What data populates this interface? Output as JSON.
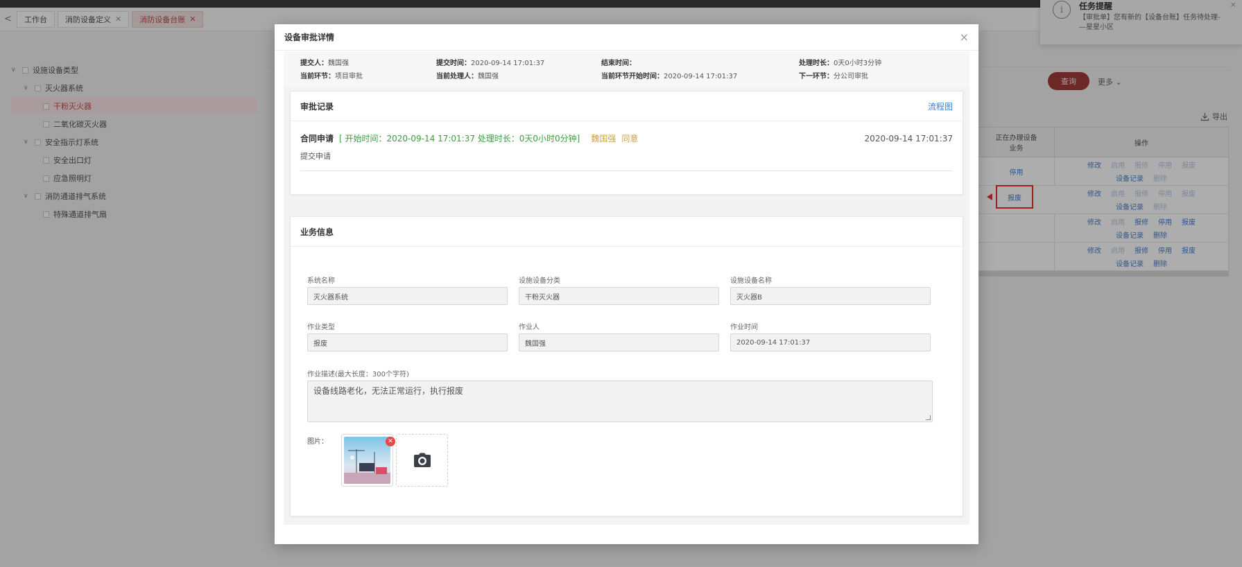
{
  "tabbar": {
    "nav": "<",
    "tabs": [
      {
        "label": "工作台",
        "closable": false,
        "active": false
      },
      {
        "label": "消防设备定义",
        "closable": true,
        "active": false
      },
      {
        "label": "消防设备台账",
        "closable": true,
        "active": true
      }
    ]
  },
  "tree": {
    "items": [
      {
        "label": "设施设备类型",
        "level": 1,
        "expanded": true
      },
      {
        "label": "灭火器系统",
        "level": 2,
        "expanded": true
      },
      {
        "label": "干粉灭火器",
        "level": 3,
        "selected": true
      },
      {
        "label": "二氧化碳灭火器",
        "level": 3
      },
      {
        "label": "安全指示灯系统",
        "level": 2,
        "expanded": true
      },
      {
        "label": "安全出口灯",
        "level": 3
      },
      {
        "label": "应急照明灯",
        "level": 3
      },
      {
        "label": "消防通道排气系统",
        "level": 2,
        "expanded": true
      },
      {
        "label": "特殊通道排气扇",
        "level": 3
      }
    ]
  },
  "toolbar": {
    "query_label": "查询",
    "more_label": "更多",
    "export_label": "导出"
  },
  "table": {
    "headers": {
      "busy": "正在办理设备业务",
      "ops": "操作"
    },
    "rows": [
      {
        "busy": "停用",
        "ops1": [
          "修改",
          "启用",
          "报修",
          "停用",
          "报废"
        ],
        "ops2": [
          "设备记录",
          "删除"
        ],
        "enabled1": [
          true,
          false,
          false,
          false,
          false
        ],
        "enabled2": [
          true,
          false
        ]
      },
      {
        "busy": "报废",
        "ops1": [
          "修改",
          "启用",
          "报修",
          "停用",
          "报废"
        ],
        "ops2": [
          "设备记录",
          "删除"
        ],
        "enabled1": [
          true,
          false,
          false,
          false,
          false
        ],
        "enabled2": [
          true,
          false
        ]
      },
      {
        "busy": "",
        "ops1": [
          "修改",
          "启用",
          "报修",
          "停用",
          "报废"
        ],
        "ops2": [
          "设备记录",
          "删除"
        ],
        "enabled1": [
          true,
          false,
          true,
          true,
          true
        ],
        "enabled2": [
          true,
          true
        ]
      },
      {
        "busy": "",
        "ops1": [
          "修改",
          "启用",
          "报修",
          "停用",
          "报废"
        ],
        "ops2": [
          "设备记录",
          "删除"
        ],
        "enabled1": [
          true,
          false,
          true,
          true,
          true
        ],
        "enabled2": [
          true,
          true
        ]
      }
    ]
  },
  "notification": {
    "title": "任务提醒",
    "text": "【审批单】您有新的【设备台账】任务待处理-—星星小区",
    "close": "×"
  },
  "modal": {
    "title": "设备审批详情",
    "close": "×",
    "meta": {
      "submitter_label": "提交人：",
      "submitter": "魏国强",
      "submit_time_label": "提交时间：",
      "submit_time": "2020-09-14 17:01:37",
      "end_time_label": "结束时间：",
      "end_time": "",
      "duration_label": "处理时长：",
      "duration": "0天0小时3分钟",
      "stage_label": "当前环节：",
      "stage": "项目审批",
      "handler_label": "当前处理人：",
      "handler": "魏国强",
      "stage_start_label": "当前环节开始时间：",
      "stage_start": "2020-09-14 17:01:37",
      "next_label": "下一环节：",
      "next": "分公司审批"
    },
    "records": {
      "title": "审批记录",
      "flowchart_link": "流程图",
      "entry": {
        "name": "合同申请",
        "detail": "[ 开始时间：2020-09-14 17:01:37    处理时长：0天0小时0分钟]",
        "handler": "魏国强",
        "result": "同意",
        "time": "2020-09-14 17:01:37",
        "action": "提交申请"
      }
    },
    "business": {
      "title": "业务信息",
      "fields": {
        "system_name_label": "系统名称",
        "system_name": "灭火器系统",
        "category_label": "设施设备分类",
        "category": "干粉灭火器",
        "device_name_label": "设施设备名称",
        "device_name": "灭火器B",
        "work_type_label": "作业类型",
        "work_type": "报废",
        "worker_label": "作业人",
        "worker": "魏国强",
        "work_time_label": "作业时间",
        "work_time": "2020-09-14 17:01:37",
        "desc_label": "作业描述(最大长度：300个字符)",
        "desc": "设备线路老化，无法正常运行，执行报废",
        "pics_label": "图片："
      }
    }
  },
  "colors": {
    "accent": "#a23a3a",
    "link": "#3d7ed8",
    "green": "#3c9d3c",
    "gold": "#c9a14a",
    "highlight": "#e63030"
  }
}
